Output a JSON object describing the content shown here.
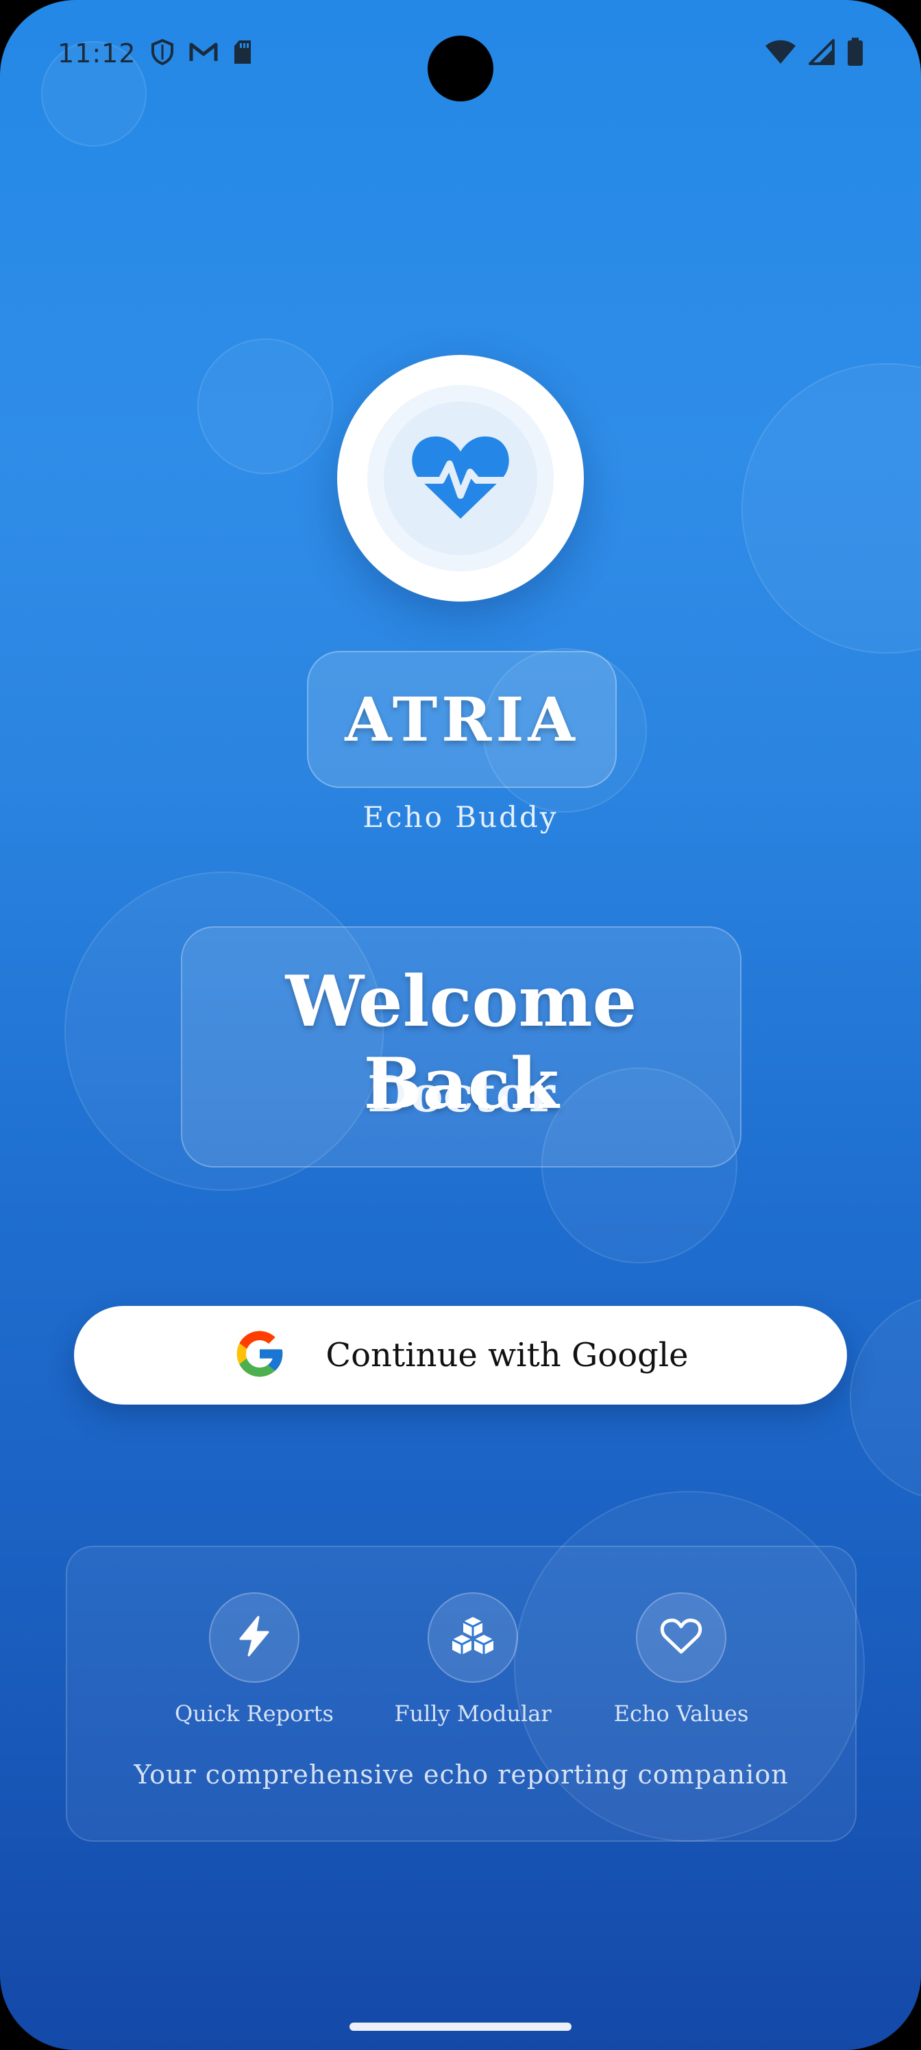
{
  "status_bar": {
    "time": "11:12",
    "left_icons": [
      "shield-icon",
      "gmail-icon",
      "sd-card-icon"
    ],
    "right_icons": [
      "wifi-icon",
      "cellular-signal-icon",
      "battery-icon"
    ]
  },
  "app": {
    "logo_icon": "heart-pulse-icon",
    "name": "ATRIA",
    "subtitle": "Echo Buddy"
  },
  "welcome": {
    "title": "Welcome Back",
    "subtitle": "Doctor"
  },
  "google_button": {
    "icon": "google-icon",
    "label": "Continue with Google"
  },
  "features": {
    "items": [
      {
        "icon": "lightning-icon",
        "label": "Quick Reports"
      },
      {
        "icon": "cubes-icon",
        "label": "Fully Modular"
      },
      {
        "icon": "heart-outline-icon",
        "label": "Echo Values"
      }
    ],
    "tagline": "Your comprehensive echo reporting companion"
  },
  "colors": {
    "background_top": "#2488e6",
    "background_bottom": "#1449a8",
    "accent_blue": "#2486e6",
    "button_background": "#ffffff",
    "text_on_button": "#111111"
  }
}
